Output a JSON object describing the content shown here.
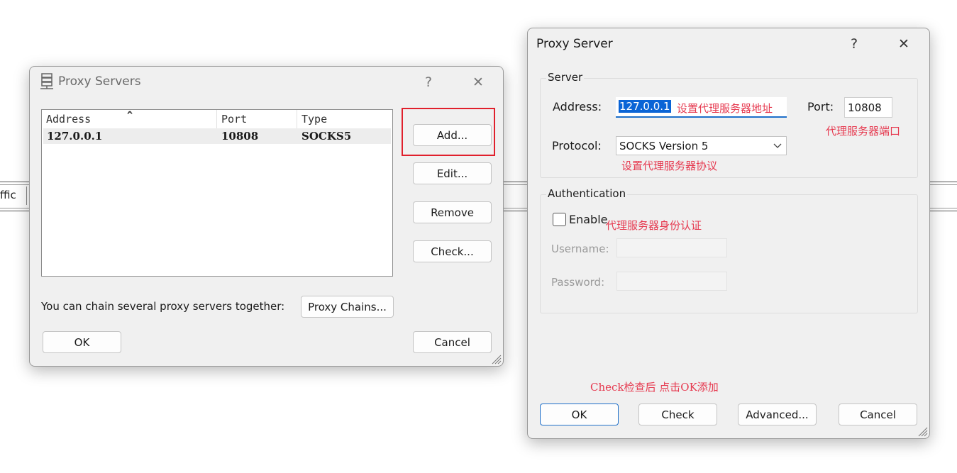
{
  "background": {
    "partial_text": "ffic"
  },
  "proxy_servers_dialog": {
    "title": "Proxy Servers",
    "help": "?",
    "close": "✕",
    "columns": [
      "Address",
      "Port",
      "Type"
    ],
    "sort_indicator": "ˆ",
    "rows": [
      {
        "address": "127.0.0.1",
        "port": "10808",
        "type": "SOCKS5"
      }
    ],
    "buttons": {
      "add": "Add...",
      "edit": "Edit...",
      "remove": "Remove",
      "check": "Check..."
    },
    "chain_text": "You can chain several proxy servers together:",
    "proxy_chains": "Proxy Chains...",
    "ok": "OK",
    "cancel": "Cancel",
    "highlight_color": "#e0202c"
  },
  "proxy_server_dialog": {
    "title": "Proxy Server",
    "help": "?",
    "close": "✕",
    "server_group": "Server",
    "address_label": "Address:",
    "address_value": "127.0.0.1",
    "address_annotation": "设置代理服务器地址",
    "port_label": "Port:",
    "port_value": "10808",
    "port_annotation": "代理服务器端口",
    "protocol_label": "Protocol:",
    "protocol_value": "SOCKS Version 5",
    "protocol_annotation": "设置代理服务器协议",
    "auth_group": "Authentication",
    "enable_label": "Enable",
    "enable_checked": false,
    "enable_annotation": "代理服务器身份认证",
    "username_label": "Username:",
    "password_label": "Password:",
    "footer_annotation": "Check检查后 点击OK添加",
    "buttons": {
      "ok": "OK",
      "check": "Check",
      "advanced": "Advanced...",
      "cancel": "Cancel"
    },
    "annotation_color": "#e6394f",
    "selection_color": "#0a64d6"
  }
}
